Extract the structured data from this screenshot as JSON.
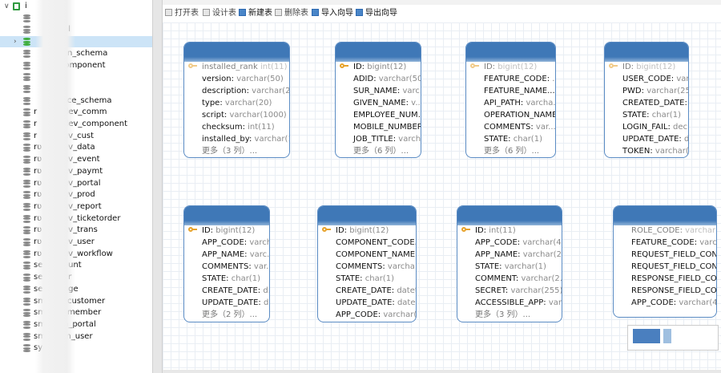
{
  "tree": {
    "items": [
      {
        "label": "i",
        "type": "root"
      },
      {
        "label": "ust",
        "type": "db"
      },
      {
        "label": "ortal",
        "type": "db"
      },
      {
        "label": "aa",
        "type": "db-selected"
      },
      {
        "label": "ation_schema",
        "type": "db"
      },
      {
        "label": "d-component",
        "type": "db"
      },
      {
        "label": "",
        "type": "db"
      },
      {
        "label": "_sql",
        "type": "db"
      },
      {
        "label": "nance_schema",
        "type": "db"
      },
      {
        "label": "r",
        "suffix": "dev_comm",
        "type": "db"
      },
      {
        "label": "r",
        "suffix": "dev_component",
        "type": "db"
      },
      {
        "label": "r",
        "suffix": "ev_cust",
        "type": "db"
      },
      {
        "label": "rʋ",
        "suffix": "ev_data",
        "type": "db"
      },
      {
        "label": "rʋ",
        "suffix": "ev_event",
        "type": "db"
      },
      {
        "label": "rʋ",
        "suffix": "ev_paymt",
        "type": "db"
      },
      {
        "label": "rʋ",
        "suffix": "ev_portal",
        "type": "db"
      },
      {
        "label": "rʋ",
        "suffix": "ev_prod",
        "type": "db"
      },
      {
        "label": "rʋ",
        "suffix": "ev_report",
        "type": "db"
      },
      {
        "label": "rʋ",
        "suffix": "ev_ticketorder",
        "type": "db"
      },
      {
        "label": "rʋ",
        "suffix": "ev_trans",
        "type": "db"
      },
      {
        "label": "rʋ",
        "suffix": "ev_user",
        "type": "db"
      },
      {
        "label": "rʋ",
        "suffix": "ev_workflow",
        "type": "db"
      },
      {
        "label": "se",
        "suffix": "ount",
        "type": "db"
      },
      {
        "label": "se",
        "suffix": "er",
        "type": "db"
      },
      {
        "label": "se",
        "suffix": "age",
        "type": "db"
      },
      {
        "label": "sm",
        "suffix": "_customer",
        "type": "db"
      },
      {
        "label": "sm",
        "suffix": "_member",
        "type": "db"
      },
      {
        "label": "sm",
        "suffix": "n_portal",
        "type": "db"
      },
      {
        "label": "sm",
        "suffix": "m_user",
        "type": "db"
      },
      {
        "label": "sys",
        "type": "db"
      }
    ]
  },
  "toolbar": {
    "open_label": "打开表",
    "design_label": "设计表",
    "new_label": "新建表",
    "delete_label": "删除表",
    "import_label": "导入向导",
    "export_label": "导出向导"
  },
  "cards": [
    {
      "id": "c1",
      "fields": [
        {
          "name": "installed_rank",
          "type": "int(11)",
          "key": true,
          "faded": true
        },
        {
          "name": "version:",
          "type": "varchar(50)"
        },
        {
          "name": "description:",
          "type": "varchar(20..."
        },
        {
          "name": "type:",
          "type": "varchar(20)"
        },
        {
          "name": "script:",
          "type": "varchar(1000)"
        },
        {
          "name": "checksum:",
          "type": "int(11)"
        },
        {
          "name": "installed_by:",
          "type": "varchar(1..."
        }
      ],
      "more": "更多（3 列）..."
    },
    {
      "id": "c2",
      "fields": [
        {
          "name": "ID:",
          "type": "bigint(12)",
          "key": true
        },
        {
          "name": "ADID:",
          "type": "varchar(50)"
        },
        {
          "name": "SUR_NAME:",
          "type": "varc..."
        },
        {
          "name": "GIVEN_NAME:",
          "type": "v..."
        },
        {
          "name": "EMPLOYEE_NUM...",
          "type": ""
        },
        {
          "name": "MOBILE_NUMBER...",
          "type": ""
        },
        {
          "name": "JOB_TITLE:",
          "type": "varch..."
        }
      ],
      "more": "更多（6 列）..."
    },
    {
      "id": "c3",
      "fields": [
        {
          "name": "ID:",
          "type": "bigint(12)",
          "key": true,
          "faded": true
        },
        {
          "name": "FEATURE_CODE:",
          "type": "..."
        },
        {
          "name": "FEATURE_NAME...",
          "type": ""
        },
        {
          "name": "API_PATH:",
          "type": "varcha..."
        },
        {
          "name": "OPERATION_NAME",
          "type": ""
        },
        {
          "name": "COMMENTS:",
          "type": "var..."
        },
        {
          "name": "STATE:",
          "type": "char(1)"
        }
      ],
      "more": "更多（6 列）..."
    },
    {
      "id": "c4",
      "fields": [
        {
          "name": "ID:",
          "type": "bigint(12)",
          "key": true,
          "faded": true
        },
        {
          "name": "USER_CODE:",
          "type": "var..."
        },
        {
          "name": "PWD:",
          "type": "varchar(255)"
        },
        {
          "name": "CREATED_DATE:",
          "type": "..."
        },
        {
          "name": "STATE:",
          "type": "char(1)"
        },
        {
          "name": "LOGIN_FAIL:",
          "type": "deci..."
        },
        {
          "name": "UPDATE_DATE:",
          "type": "d..."
        },
        {
          "name": "TOKEN:",
          "type": "varchar(..."
        }
      ],
      "more": ""
    },
    {
      "id": "c5",
      "fields": [
        {
          "name": "ID:",
          "type": "bigint(12)",
          "key": true
        },
        {
          "name": "APP_CODE:",
          "type": "varch..."
        },
        {
          "name": "APP_NAME:",
          "type": "varc..."
        },
        {
          "name": "COMMENTS:",
          "type": "var..."
        },
        {
          "name": "STATE:",
          "type": "char(1)"
        },
        {
          "name": "CREATE_DATE:",
          "type": "d..."
        },
        {
          "name": "UPDATE_DATE:",
          "type": "d..."
        }
      ],
      "more": "更多（2 列）..."
    },
    {
      "id": "c6",
      "fields": [
        {
          "name": "ID:",
          "type": "bigint(12)",
          "key": true
        },
        {
          "name": "COMPONENT_CODE...",
          "type": ""
        },
        {
          "name": "COMPONENT_NAME...",
          "type": ""
        },
        {
          "name": "COMMENTS:",
          "type": "varcha..."
        },
        {
          "name": "STATE:",
          "type": "char(1)"
        },
        {
          "name": "CREATE_DATE:",
          "type": "datet..."
        },
        {
          "name": "UPDATE_DATE:",
          "type": "date..."
        },
        {
          "name": "APP_CODE:",
          "type": "varchar(..."
        }
      ],
      "more": ""
    },
    {
      "id": "c7",
      "fields": [
        {
          "name": "ID:",
          "type": "int(11)",
          "key": true
        },
        {
          "name": "APP_CODE:",
          "type": "varchar(40)"
        },
        {
          "name": "APP_NAME:",
          "type": "varchar(2..."
        },
        {
          "name": "STATE:",
          "type": "varchar(1)"
        },
        {
          "name": "COMMENT:",
          "type": "varchar(2..."
        },
        {
          "name": "SECRET:",
          "type": "varchar(255)"
        },
        {
          "name": "ACCESSIBLE_APP:",
          "type": "varc..."
        }
      ],
      "more": "更多（3 列）..."
    },
    {
      "id": "c8",
      "fields": [
        {
          "name": "ROLE_CODE:",
          "type": "varchar(...",
          "faded": true
        },
        {
          "name": "FEATURE_CODE:",
          "type": "varchar(..."
        },
        {
          "name": "REQUEST_FIELD_CON...",
          "type": ""
        },
        {
          "name": "REQUEST_FIELD_CON...",
          "type": ""
        },
        {
          "name": "RESPONSE_FIELD_CO...",
          "type": ""
        },
        {
          "name": "RESPONSE_FIELD_CO...",
          "type": ""
        },
        {
          "name": "APP_CODE:",
          "type": "varchar(40)"
        }
      ],
      "more": ""
    }
  ],
  "colors": {
    "header": "#3f78b7",
    "border": "#5b8cc4",
    "key": "#e7a22a",
    "selected": "#cce4f7"
  }
}
